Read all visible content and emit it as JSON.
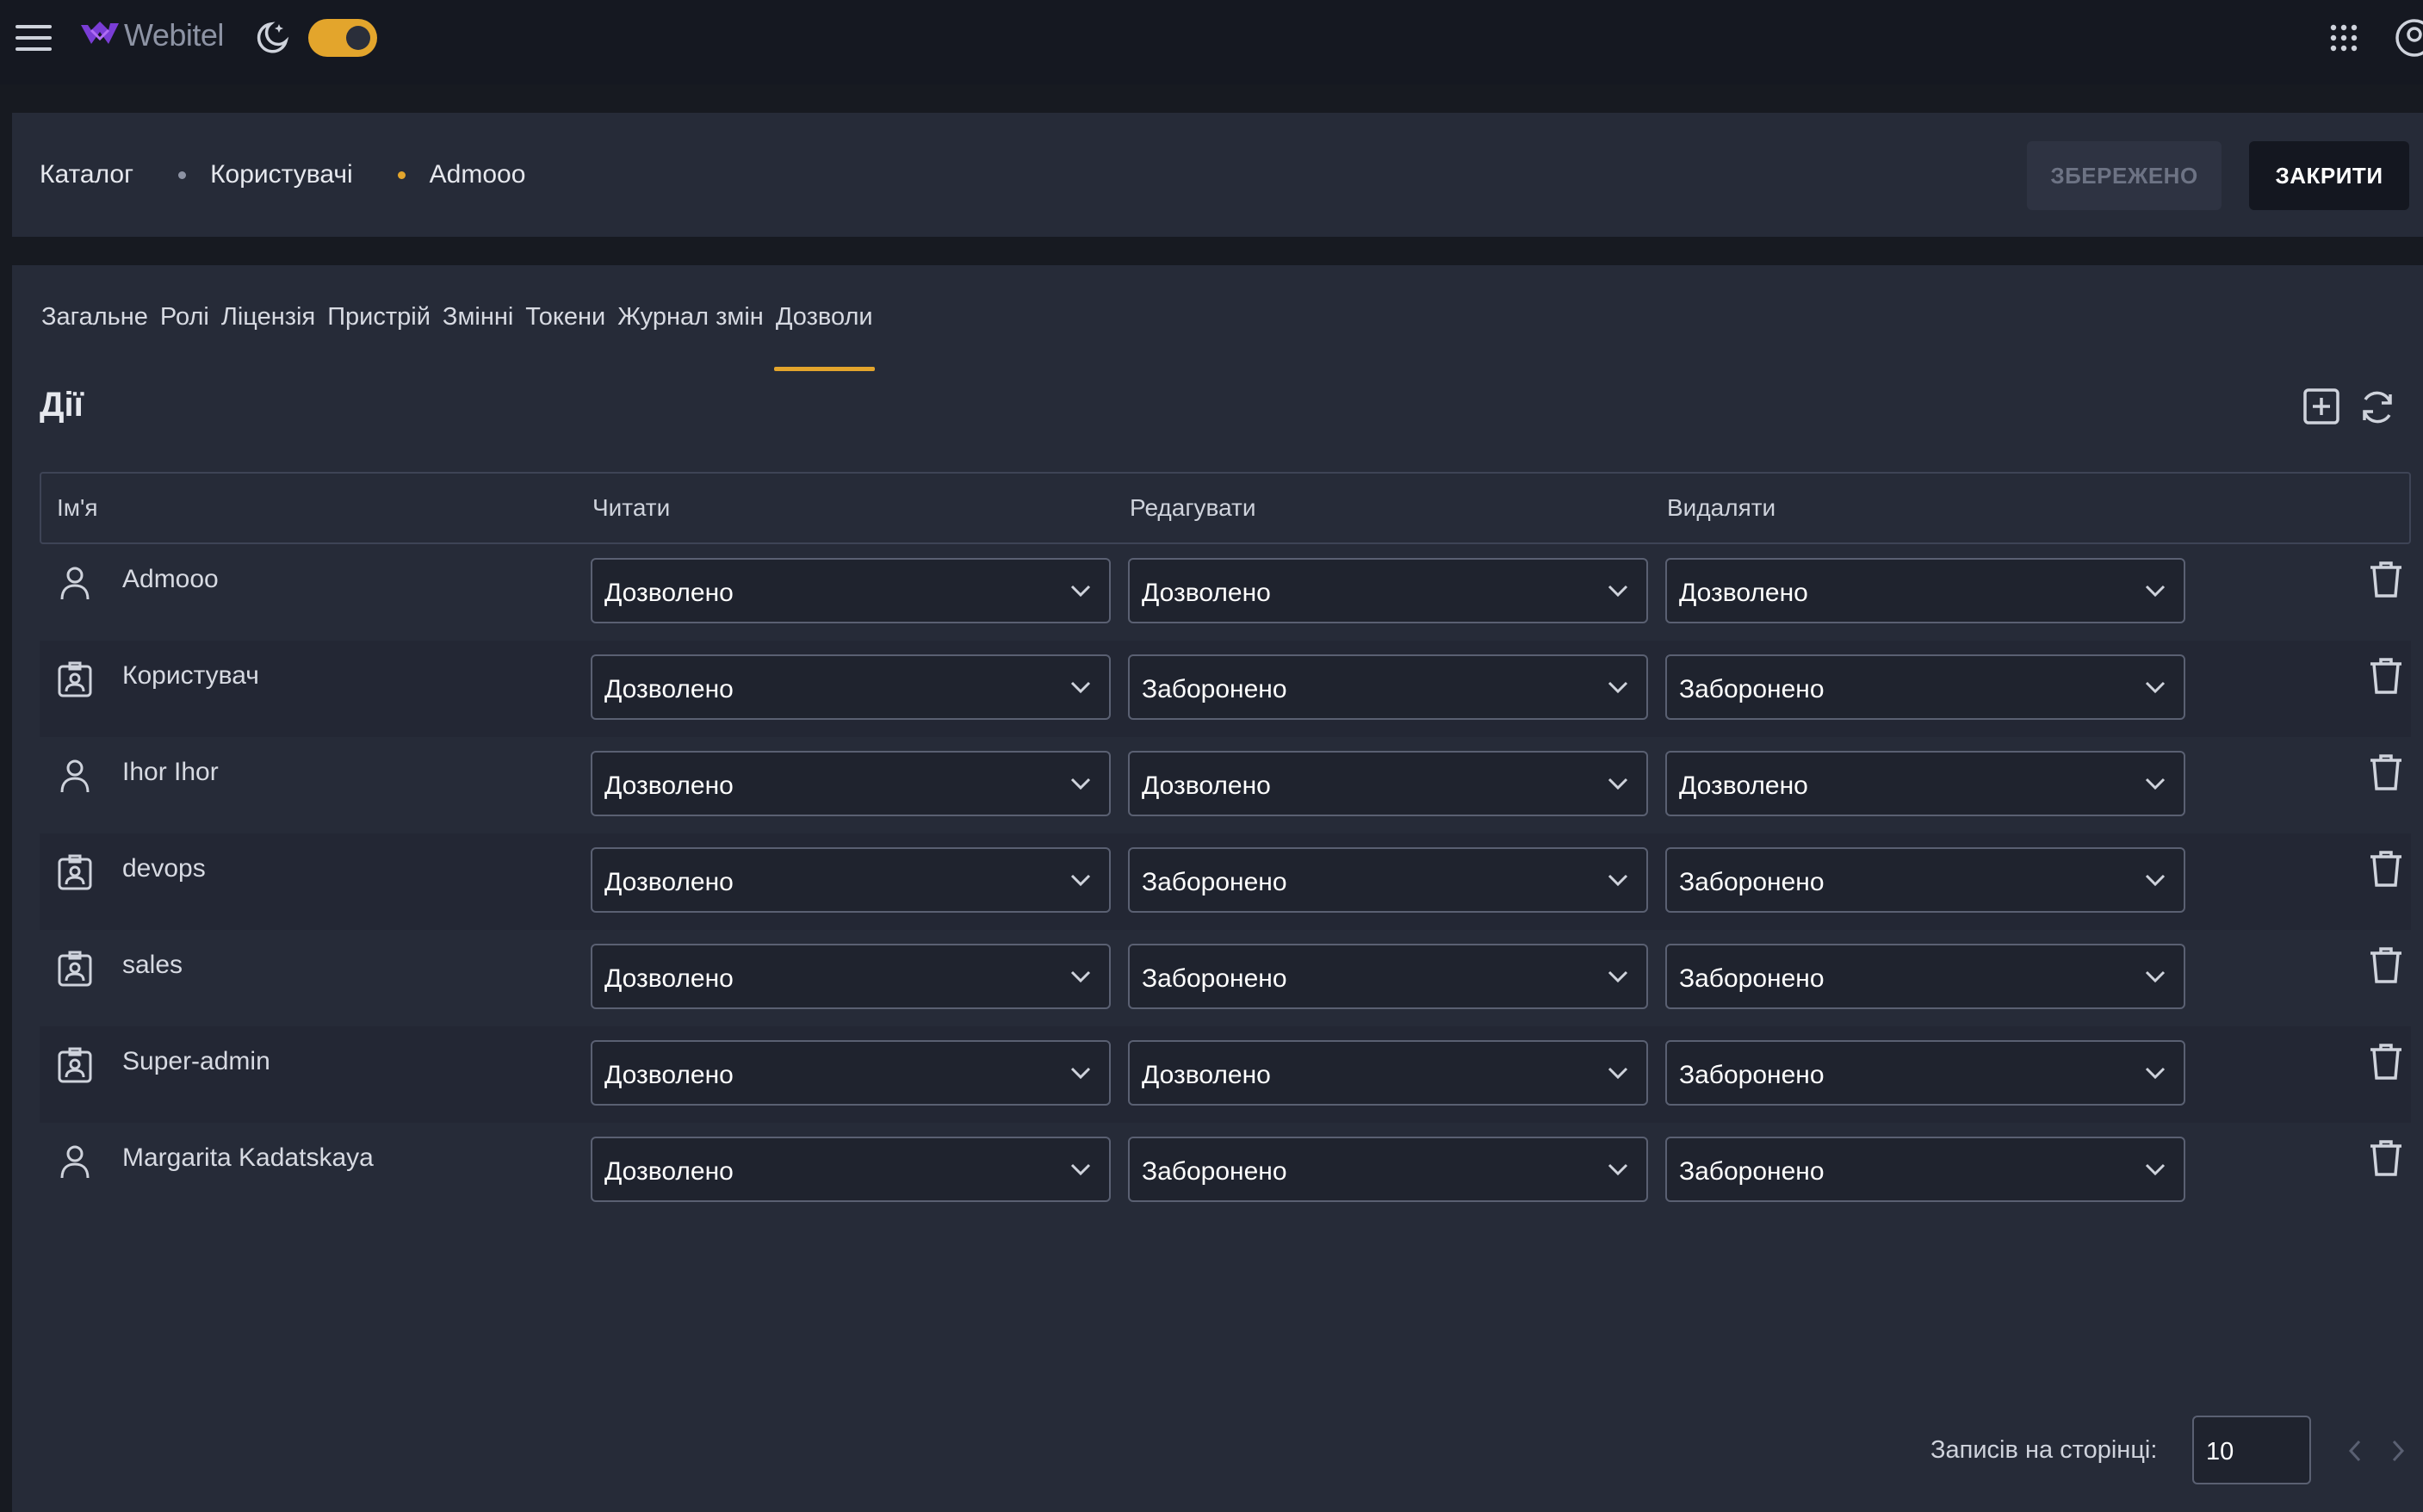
{
  "topbar": {
    "logo_text": "Webitel",
    "icons": [
      "hamburger-icon",
      "moon-icon",
      "apps-grid-icon",
      "account-icon"
    ],
    "theme_toggle_on": true,
    "accent": "#e3a52c"
  },
  "breadcrumb": [
    "Каталог",
    "Користувачі",
    "Admooo"
  ],
  "header": {
    "saved_label": "ЗБЕРЕЖЕНО",
    "close_label": "ЗАКРИТИ"
  },
  "tabs": [
    "Загальне",
    "Ролі",
    "Ліцензія",
    "Пристрій",
    "Змінні",
    "Токени",
    "Журнал змін",
    "Дозволи"
  ],
  "active_tab": "Дозволи",
  "section": {
    "title": "Дії"
  },
  "table": {
    "columns": [
      "Ім'я",
      "Читати",
      "Редагувати",
      "Видаляти"
    ],
    "rows": [
      {
        "name": "Admooo",
        "icon": "user-icon",
        "read": "Дозволено",
        "edit": "Дозволено",
        "delete": "Дозволено"
      },
      {
        "name": "Користувач",
        "icon": "role-badge-icon",
        "read": "Дозволено",
        "edit": "Заборонено",
        "delete": "Заборонено"
      },
      {
        "name": "Ihor Ihor",
        "icon": "user-icon",
        "read": "Дозволено",
        "edit": "Дозволено",
        "delete": "Дозволено"
      },
      {
        "name": "devops",
        "icon": "role-badge-icon",
        "read": "Дозволено",
        "edit": "Заборонено",
        "delete": "Заборонено"
      },
      {
        "name": "sales",
        "icon": "role-badge-icon",
        "read": "Дозволено",
        "edit": "Заборонено",
        "delete": "Заборонено"
      },
      {
        "name": "Super-admin",
        "icon": "role-badge-icon",
        "read": "Дозволено",
        "edit": "Дозволено",
        "delete": "Заборонено"
      },
      {
        "name": "Margarita Kadatskaya",
        "icon": "user-icon",
        "read": "Дозволено",
        "edit": "Заборонено",
        "delete": "Заборонено"
      }
    ]
  },
  "pagination": {
    "label": "Записів на сторінці:",
    "per_page": "10"
  }
}
